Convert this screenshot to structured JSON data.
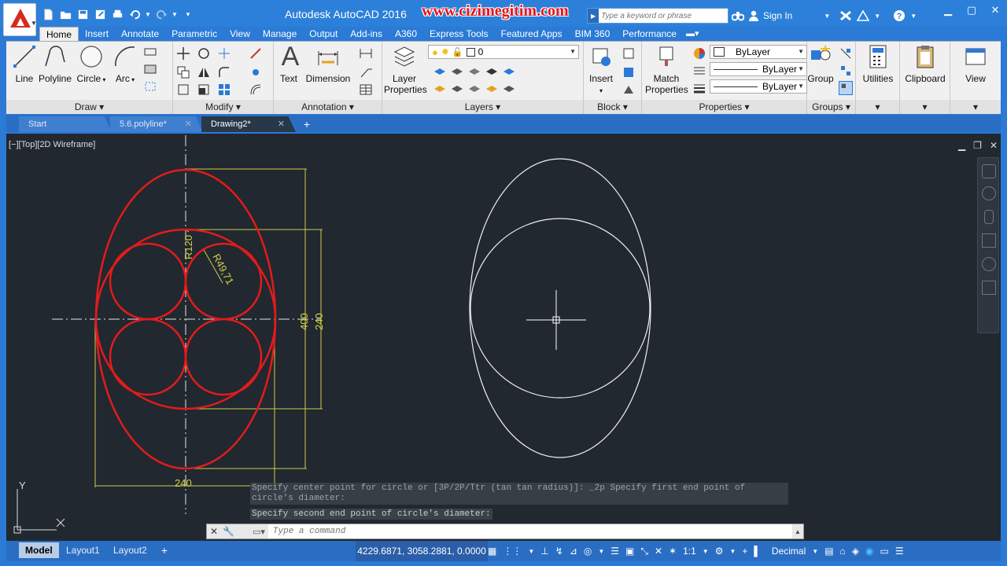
{
  "titlebar": {
    "app_title": "Autodesk AutoCAD 2016",
    "watermark": "www.cizimegitim.com",
    "search_placeholder": "Type a keyword or phrase",
    "sign_in": "Sign In"
  },
  "ribbon_tabs": [
    "Home",
    "Insert",
    "Annotate",
    "Parametric",
    "View",
    "Manage",
    "Output",
    "Add-ins",
    "A360",
    "Express Tools",
    "Featured Apps",
    "BIM 360",
    "Performance"
  ],
  "panels": {
    "draw": {
      "title": "Draw",
      "line": "Line",
      "polyline": "Polyline",
      "circle": "Circle",
      "arc": "Arc"
    },
    "modify": {
      "title": "Modify"
    },
    "annotation": {
      "title": "Annotation",
      "text": "Text",
      "dimension": "Dimension"
    },
    "layers": {
      "title": "Layers",
      "layer_properties_1": "Layer",
      "layer_properties_2": "Properties",
      "current_layer": "0"
    },
    "block": {
      "title": "Block",
      "insert": "Insert"
    },
    "properties": {
      "title": "Properties",
      "match_1": "Match",
      "match_2": "Properties",
      "color": "ByLayer",
      "linetype": "ByLayer",
      "lineweight": "ByLayer"
    },
    "groups": {
      "title": "Groups",
      "group": "Group"
    },
    "utilities": {
      "label": "Utilities"
    },
    "clipboard": {
      "label": "Clipboard"
    },
    "view": {
      "label": "View"
    }
  },
  "file_tabs": [
    "Start",
    "5.6.polyline*",
    "Drawing2*"
  ],
  "viewport": {
    "label": "[−][Top][2D Wireframe]",
    "dim_r120": "R120",
    "dim_r4971": "R49,71",
    "dim_400": "400",
    "dim_240_v": "240",
    "dim_240_h": "240",
    "ucs_y": "Y",
    "ucs_x": "X"
  },
  "command": {
    "history_1": "Specify center point for circle or [3P/2P/Ttr (tan tan radius)]: _2p Specify first end point of circle's diameter:",
    "history_2": "Specify second end point of circle's diameter:",
    "placeholder": "Type a command"
  },
  "status": {
    "layout_tabs": [
      "Model",
      "Layout1",
      "Layout2"
    ],
    "coords": "4229.6871, 3058.2881, 0.0000",
    "scale": "1:1",
    "units": "Decimal"
  },
  "colors": {
    "accent": "#2a7ad6",
    "canvas": "#212830",
    "red_geom": "#e31b1b",
    "dim_yellow": "#d6d244"
  }
}
